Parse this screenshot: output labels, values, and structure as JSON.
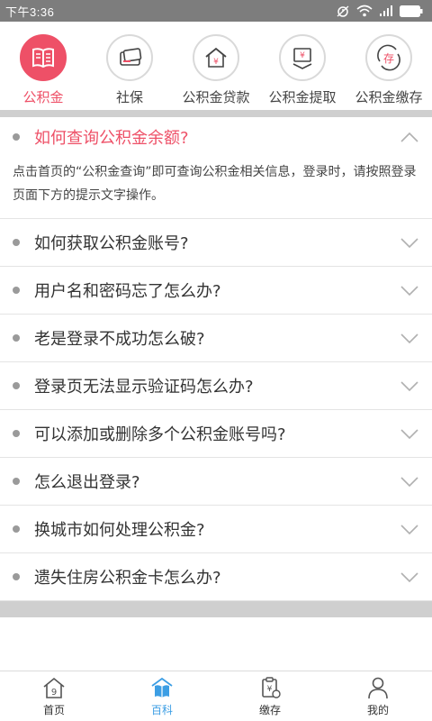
{
  "status_bar": {
    "time": "下午3:36"
  },
  "categories": [
    {
      "label": "公积金",
      "icon": "book-icon",
      "active": true
    },
    {
      "label": "社保",
      "icon": "card-icon",
      "active": false
    },
    {
      "label": "公积金贷款",
      "icon": "house-yen-icon",
      "active": false
    },
    {
      "label": "公积金提取",
      "icon": "yen-withdraw-icon",
      "active": false
    },
    {
      "label": "公积金缴存",
      "icon": "deposit-icon",
      "active": false
    }
  ],
  "faq": [
    {
      "question": "如何查询公积金余额?",
      "expanded": true,
      "answer": "点击首页的“公积金查询”即可查询公积金相关信息，登录时，请按照登录页面下方的提示文字操作。"
    },
    {
      "question": "如何获取公积金账号?",
      "expanded": false
    },
    {
      "question": "用户名和密码忘了怎么办?",
      "expanded": false
    },
    {
      "question": "老是登录不成功怎么破?",
      "expanded": false
    },
    {
      "question": "登录页无法显示验证码怎么办?",
      "expanded": false
    },
    {
      "question": "可以添加或删除多个公积金账号吗?",
      "expanded": false
    },
    {
      "question": "怎么退出登录?",
      "expanded": false
    },
    {
      "question": "换城市如何处理公积金?",
      "expanded": false
    },
    {
      "question": "遗失住房公积金卡怎么办?",
      "expanded": false
    }
  ],
  "tabs": [
    {
      "label": "首页",
      "icon": "home-icon",
      "active": false
    },
    {
      "label": "百科",
      "icon": "encyclopedia-icon",
      "active": true
    },
    {
      "label": "缴存",
      "icon": "clipboard-yen-icon",
      "active": false
    },
    {
      "label": "我的",
      "icon": "user-icon",
      "active": false
    }
  ],
  "colors": {
    "accent": "#ee5067",
    "tab_active": "#3c9ee4",
    "status_bar": "#7d7d7d"
  }
}
